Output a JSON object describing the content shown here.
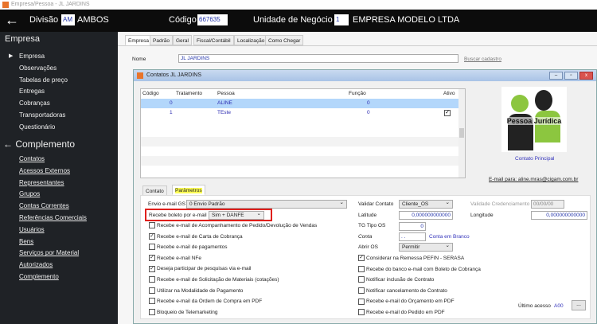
{
  "window_title": "Empresa/Pessoa - JL JARDINS",
  "header": {
    "divisao_label": "Divisão",
    "divisao_code": "AM",
    "divisao_name": "AMBOS",
    "codigo_label": "Código",
    "codigo_value": "667635",
    "unidade_label": "Unidade de Negócio",
    "unidade_code": "1",
    "unidade_name": "EMPRESA MODELO LTDA"
  },
  "sidebar": {
    "section1": "Empresa",
    "items": [
      "Empresa",
      "Observações",
      "Tabelas de preço",
      "Entregas",
      "Cobranças",
      "Transportadoras",
      "Questionário"
    ],
    "section2": "Complemento",
    "links": [
      "Contatos",
      "Acessos Externos",
      "Representantes",
      "Grupos",
      "Contas Correntes",
      "Referências Comerciais",
      "Usuários",
      "Bens",
      "Serviços por Material",
      "Autorizados",
      "Complemento"
    ]
  },
  "tabs": [
    "Empresa",
    "Padrão",
    "Geral",
    "Fiscal/Contábil",
    "Localização",
    "Como Chegar"
  ],
  "nome_label": "Nome",
  "nome_value": "JL JARDINS",
  "buscar_link": "Buscar cadastro",
  "dialog": {
    "title": "Contatos JL JARDINS",
    "columns": [
      "Código",
      "Tratamento",
      "Pessoa",
      "Função",
      "Ativo"
    ],
    "rows": [
      {
        "codigo": "0",
        "tratamento": "",
        "pessoa": "ALINE",
        "funcao": "0",
        "ativo": false
      },
      {
        "codigo": "1",
        "tratamento": "",
        "pessoa": "TEste",
        "funcao": "0",
        "ativo": true
      }
    ],
    "image_text": "Pessoa Jurídica",
    "contato_principal": "Contato Principal",
    "email_link": "E-mail para: aline.mras@cigam.com.br",
    "subtabs": [
      "Contato",
      "Parâmetros"
    ],
    "envio_label": "Envio e-mail GS",
    "envio_value": "0 Envio Padrão",
    "boleto_label": "Recebe boleto por e-mail",
    "boleto_value": "Sim + DANFE",
    "left_checks": [
      {
        "label": "Recebe e-mail de Acompanhamento de Pedido/Devolução de Vendas",
        "checked": false
      },
      {
        "label": "Recebe e-mail de Carta de Cobrança",
        "checked": true
      },
      {
        "label": "Recebe e-mail de pagamentos",
        "checked": false
      },
      {
        "label": "Recebe e-mail NFe",
        "checked": true
      },
      {
        "label": "Deseja participar de pesquisas via e-mail",
        "checked": true
      },
      {
        "label": "Recebe e-mail de Solicitação de Materiais (cotações)",
        "checked": false
      },
      {
        "label": "Utilizar na Modalidade de Pagamento",
        "checked": false
      },
      {
        "label": "Recebe e-mail da Ordem de Compra em PDF",
        "checked": false
      },
      {
        "label": "Bloqueio de Telemarketing",
        "checked": false
      }
    ],
    "validar_label": "Validar Contato",
    "validar_value": "Cliente_OS",
    "validade_label": "Validade Credenciamento",
    "validade_value": "00/00/00",
    "latitude_label": "Latitude",
    "latitude_value": "0,000000000000",
    "longitude_label": "Longitude",
    "longitude_value": "0,000000000000",
    "tg_label": "TG Tipo OS",
    "tg_value": "0",
    "conta_label": "Conta",
    "conta_value": ". .",
    "conta_status": "Conta em Branco",
    "abrir_label": "Abrir OS",
    "abrir_value": "Permitir",
    "right_checks": [
      {
        "label": "Considerar na Remessa PEFIN - SERASA",
        "checked": true
      },
      {
        "label": "Recebe do banco e-mail com Boleto de Cobrança",
        "checked": false
      },
      {
        "label": "Notificar inclusão de Contrato",
        "checked": false
      },
      {
        "label": "Notificar cancelamento de Contrato",
        "checked": false
      },
      {
        "label": "Recebe e-mail do Orçamento em PDF",
        "checked": false
      },
      {
        "label": "Recebe e-mail do Pedido em PDF",
        "checked": false
      }
    ],
    "ultimo_label": "Último acesso",
    "ultimo_value": "A00",
    "more_button": "..."
  },
  "colors": {
    "highlight": "#e0201c",
    "selected_row": "#b3d7fb",
    "tab_yellow": "#ffff55"
  }
}
